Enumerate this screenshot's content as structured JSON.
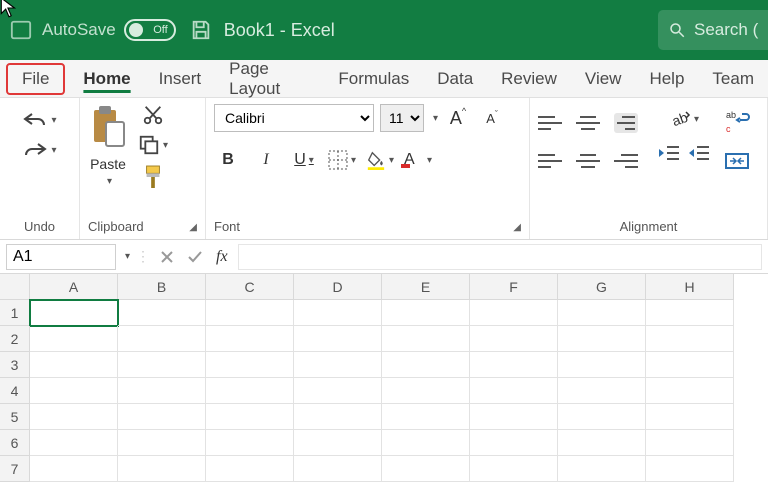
{
  "title": {
    "autosave_label": "AutoSave",
    "autosave_state": "Off",
    "book": "Book1  -  Excel",
    "search_label": "Search ("
  },
  "tabs": [
    "File",
    "Home",
    "Insert",
    "Page Layout",
    "Formulas",
    "Data",
    "Review",
    "View",
    "Help",
    "Team"
  ],
  "active_tab": "Home",
  "groups": {
    "undo": "Undo",
    "clipboard": "Clipboard",
    "font": "Font",
    "alignment": "Alignment"
  },
  "paste_label": "Paste",
  "font": {
    "name": "Calibri",
    "size": "11"
  },
  "namebox": "A1",
  "fx": "fx",
  "columns": [
    "A",
    "B",
    "C",
    "D",
    "E",
    "F",
    "G",
    "H"
  ],
  "rows": [
    "1",
    "2",
    "3",
    "4",
    "5",
    "6",
    "7"
  ],
  "selected_cell": "A1"
}
